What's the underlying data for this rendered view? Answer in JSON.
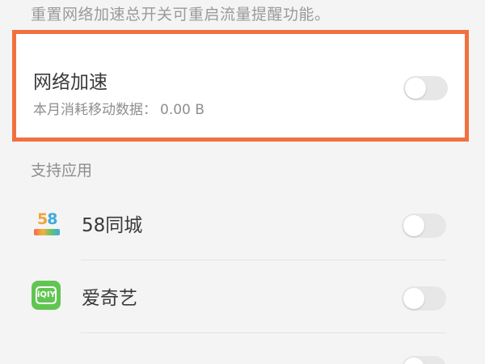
{
  "hint_text": "重置网络加速总开关可重启流量提醒功能。",
  "network_accel": {
    "title": "网络加速",
    "usage_label": "本月消耗移动数据：",
    "usage_value": "0.00 B",
    "enabled": false
  },
  "section_title": "支持应用",
  "apps": [
    {
      "name": "58同城",
      "icon": "58-tongcheng-icon",
      "icon_digits": "58",
      "enabled": false
    },
    {
      "name": "爱奇艺",
      "icon": "iqiyi-icon",
      "icon_text": "iQIY",
      "enabled": false
    },
    {
      "name": "",
      "icon": "partially-visible-app-icon",
      "enabled": false
    }
  ],
  "colors": {
    "highlight_border": "#f2703f",
    "toggle_off": "#e7e7e7",
    "iqiyi_green": "#61c552"
  }
}
